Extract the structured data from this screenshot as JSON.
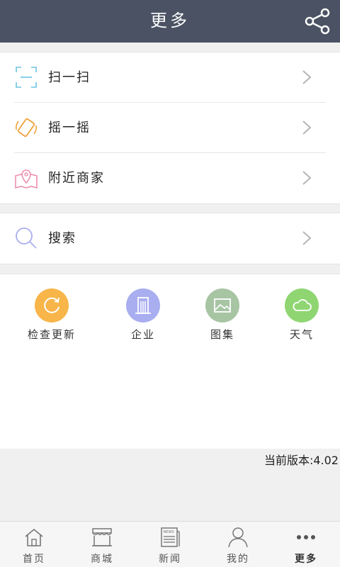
{
  "header": {
    "title": "更多"
  },
  "menu_group_1": [
    {
      "label": "扫一扫"
    },
    {
      "label": "摇一摇"
    },
    {
      "label": "附近商家"
    }
  ],
  "menu_group_2": [
    {
      "label": "搜索"
    }
  ],
  "tools": [
    {
      "label": "检查更新",
      "color": "#f7b54a"
    },
    {
      "label": "企业",
      "color": "#a9aef0"
    },
    {
      "label": "图集",
      "color": "#a7c4a3"
    },
    {
      "label": "天气",
      "color": "#8fd673"
    }
  ],
  "version_text": "当前版本:4.02",
  "tabbar": [
    {
      "label": "首页"
    },
    {
      "label": "商城"
    },
    {
      "label": "新闻"
    },
    {
      "label": "我的"
    },
    {
      "label": "更多"
    }
  ]
}
